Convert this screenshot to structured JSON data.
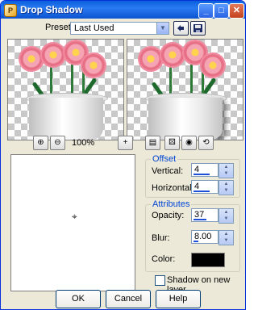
{
  "window": {
    "title": "Drop Shadow"
  },
  "title_buttons": {
    "minimize": "_",
    "maximize": "□",
    "close": "✕"
  },
  "presets": {
    "label": "Presets:",
    "value": "Last Used"
  },
  "zoom": {
    "value": "100%"
  },
  "offset": {
    "title": "Offset",
    "vertical_label": "Vertical:",
    "vertical_value": "4",
    "horizontal_label": "Horizontal:",
    "horizontal_value": "4"
  },
  "attributes": {
    "title": "Attributes",
    "opacity_label": "Opacity:",
    "opacity_value": "37",
    "blur_label": "Blur:",
    "blur_value": "8.00",
    "color_label": "Color:",
    "color_value": "#000000"
  },
  "options": {
    "shadow_new_layer_label": "Shadow on new layer"
  },
  "buttons": {
    "ok": "OK",
    "cancel": "Cancel",
    "help": "Help"
  }
}
